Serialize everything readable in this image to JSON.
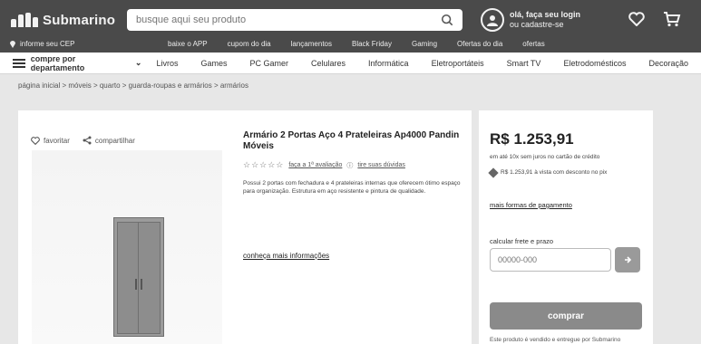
{
  "header": {
    "brand": "Submarino",
    "search_placeholder": "busque aqui seu produto",
    "account_line1": "olá, faça seu login",
    "account_line2": "ou cadastre-se",
    "cep_label": "informe seu CEP",
    "top_links": [
      "baixe o APP",
      "cupom do dia",
      "lançamentos",
      "Black Friday",
      "Gaming",
      "Ofertas do dia",
      "ofertas"
    ]
  },
  "categories": {
    "dept_label": "compre por departamento",
    "items": [
      "Livros",
      "Games",
      "PC Gamer",
      "Celulares",
      "Informática",
      "Eletroportáteis",
      "Smart TV",
      "Eletrodomésticos",
      "Decoração"
    ]
  },
  "breadcrumb": {
    "items": [
      "página inicial",
      "móveis",
      "quarto",
      "guarda-roupas e armários",
      "armários"
    ]
  },
  "product": {
    "favorite_label": "favoritar",
    "share_label": "compartilhar",
    "title": "Armário 2 Portas Aço 4 Prateleiras Ap4000 Pandin Móveis",
    "rating_stars": "☆☆☆☆☆",
    "rating_text": "faça a 1ª avaliação",
    "qa_text": "tire suas dúvidas",
    "description": "Possui 2 portas com fechadura e 4 prateleiras internas que oferecem ótimo espaço para organização. Estrutura em aço resistente e pintura de qualidade.",
    "more_link": "conheça mais informações"
  },
  "buybox": {
    "price": "R$ 1.253,91",
    "installment": "em até 10x sem juros no cartão de crédito",
    "pix_text": "R$ 1.253,91 à vista com desconto no pix",
    "payment_link": "mais formas de pagamento",
    "cep_label": "calcular frete e prazo",
    "cep_placeholder": "00000-000",
    "buy_label": "comprar",
    "seller_text": "Este produto é vendido e entregue por Submarino"
  }
}
